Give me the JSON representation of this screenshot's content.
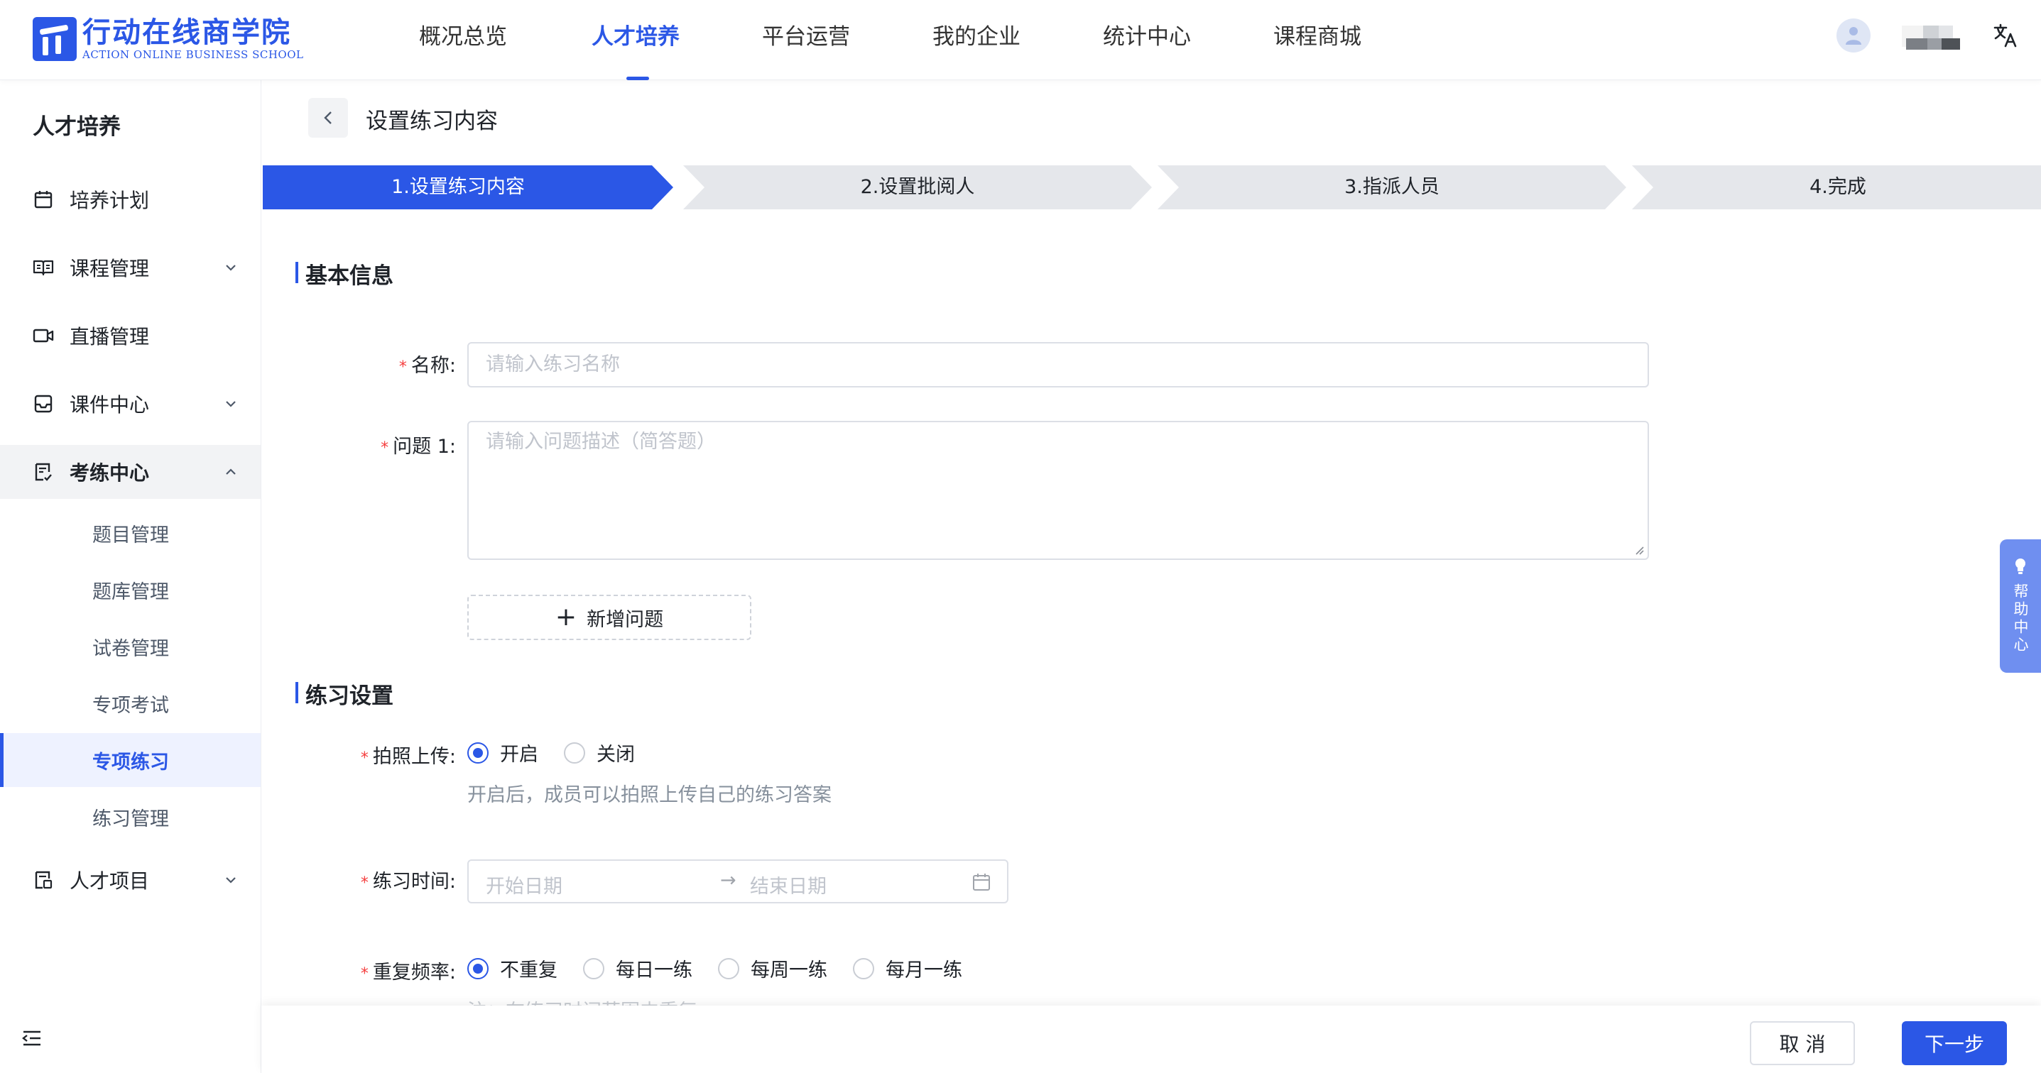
{
  "header": {
    "logo_cn": "行动在线商学院",
    "logo_en": "ACTION ONLINE BUSINESS SCHOOL",
    "nav": [
      "概况总览",
      "人才培养",
      "平台运营",
      "我的企业",
      "统计中心",
      "课程商城"
    ],
    "active_nav": "人才培养"
  },
  "sidebar": {
    "title": "人才培养",
    "items": [
      {
        "label": "培养计划",
        "icon": "calendar-icon"
      },
      {
        "label": "课程管理",
        "icon": "book-icon"
      },
      {
        "label": "直播管理",
        "icon": "video-icon"
      },
      {
        "label": "课件中心",
        "icon": "inbox-icon"
      },
      {
        "label": "考练中心",
        "icon": "exam-icon"
      },
      {
        "label": "人才项目",
        "icon": "project-icon"
      }
    ],
    "subitems": [
      "题目管理",
      "题库管理",
      "试卷管理",
      "专项考试",
      "专项练习",
      "练习管理"
    ],
    "active_subitem": "专项练习"
  },
  "page": {
    "title": "设置练习内容"
  },
  "steps": [
    "1.设置练习内容",
    "2.设置批阅人",
    "3.指派人员",
    "4.完成"
  ],
  "basic": {
    "section": "基本信息",
    "name_label": "名称:",
    "name_placeholder": "请输入练习名称",
    "q1_label": "问题 1:",
    "q1_placeholder": "请输入问题描述（简答题）",
    "add_question": "新增问题"
  },
  "settings": {
    "section": "练习设置",
    "photo_label": "拍照上传:",
    "photo_options": [
      "开启",
      "关闭"
    ],
    "photo_selected": "开启",
    "photo_hint": "开启后，成员可以拍照上传自己的练习答案",
    "time_label": "练习时间:",
    "start_placeholder": "开始日期",
    "end_placeholder": "结束日期",
    "repeat_label": "重复频率:",
    "repeat_options": [
      "不重复",
      "每日一练",
      "每周一练",
      "每月一练"
    ],
    "repeat_selected": "不重复",
    "repeat_hint": "注：在练习时间范围内重复"
  },
  "footer": {
    "cancel": "取 消",
    "next": "下一步"
  },
  "help": {
    "label": "帮助中心"
  },
  "colors": {
    "primary": "#2b57e6",
    "required": "#f53f3f",
    "step_inactive": "#e5e7eb"
  }
}
